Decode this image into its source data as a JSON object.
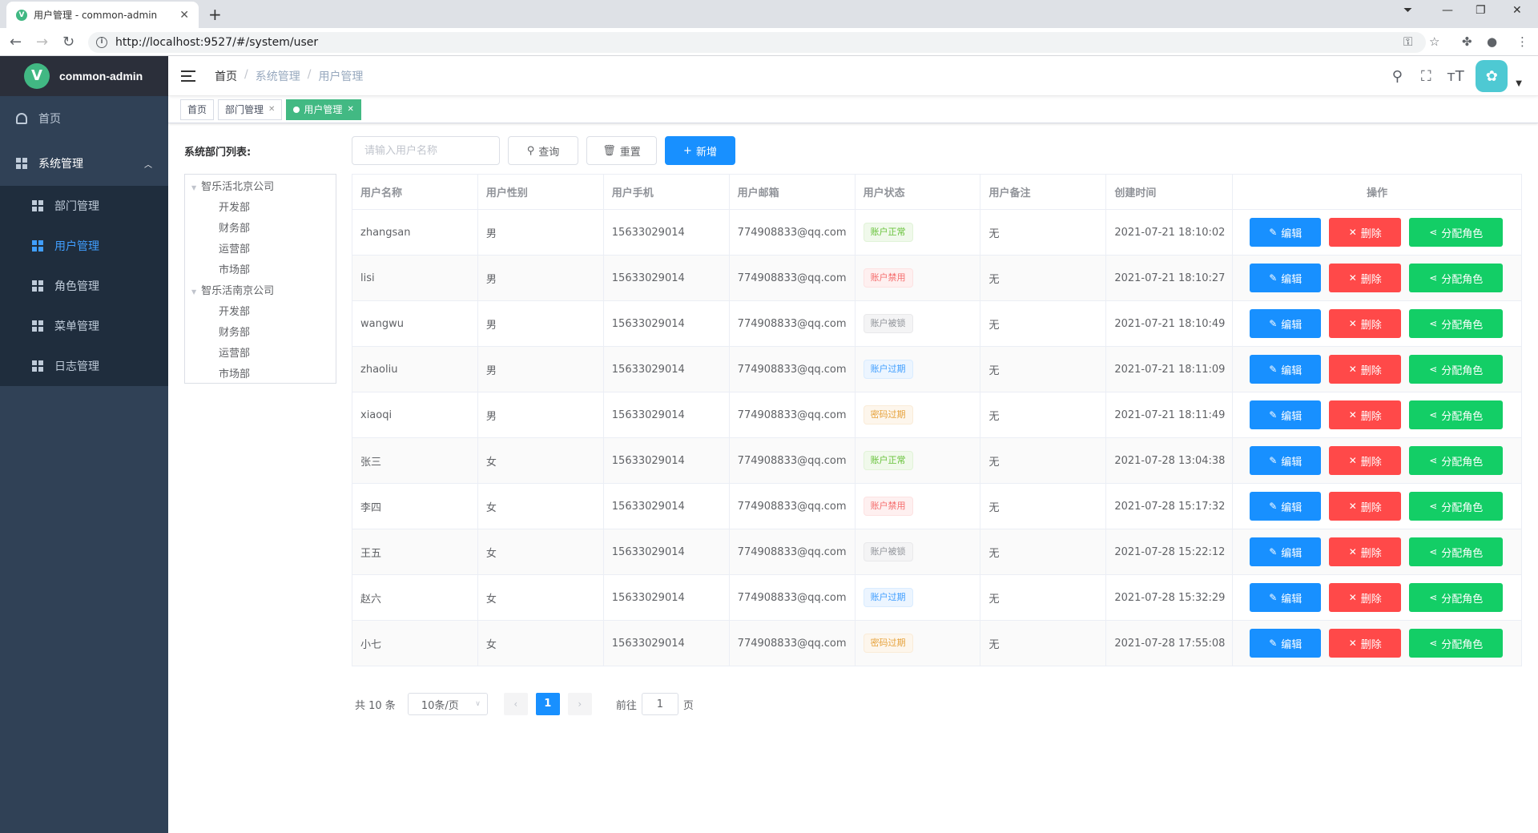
{
  "browser": {
    "tab_title": "用户管理 - common-admin",
    "url": "http://localhost:9527/#/system/user"
  },
  "logo": {
    "text": "common-admin"
  },
  "sidebar": {
    "home": "首页",
    "system": "系统管理",
    "items": [
      {
        "label": "部门管理"
      },
      {
        "label": "用户管理"
      },
      {
        "label": "角色管理"
      },
      {
        "label": "菜单管理"
      },
      {
        "label": "日志管理"
      }
    ]
  },
  "breadcrumb": {
    "b1": "首页",
    "b2": "系统管理",
    "b3": "用户管理"
  },
  "tags": {
    "t1": "首页",
    "t2": "部门管理",
    "t3": "用户管理"
  },
  "dept": {
    "title": "系统部门列表:",
    "company1": "智乐活北京公司",
    "company2": "智乐活南京公司",
    "c1": [
      "开发部",
      "财务部",
      "运营部",
      "市场部"
    ],
    "c2": [
      "开发部",
      "财务部",
      "运营部",
      "市场部"
    ]
  },
  "toolbar": {
    "search_placeholder": "请输入用户名称",
    "query": "查询",
    "reset": "重置",
    "add": "新增"
  },
  "table": {
    "headers": [
      "用户名称",
      "用户性别",
      "用户手机",
      "用户邮箱",
      "用户状态",
      "用户备注",
      "创建时间",
      "操作"
    ],
    "edit": "编辑",
    "delete": "删除",
    "assign": "分配角色",
    "rows": [
      {
        "name": "zhangsan",
        "gender": "男",
        "phone": "15633029014",
        "email": "774908833@qq.com",
        "status": "账户正常",
        "note": "无",
        "created": "2021-07-21 18:10:02"
      },
      {
        "name": "lisi",
        "gender": "男",
        "phone": "15633029014",
        "email": "774908833@qq.com",
        "status": "账户禁用",
        "note": "无",
        "created": "2021-07-21 18:10:27"
      },
      {
        "name": "wangwu",
        "gender": "男",
        "phone": "15633029014",
        "email": "774908833@qq.com",
        "status": "账户被锁",
        "note": "无",
        "created": "2021-07-21 18:10:49"
      },
      {
        "name": "zhaoliu",
        "gender": "男",
        "phone": "15633029014",
        "email": "774908833@qq.com",
        "status": "账户过期",
        "note": "无",
        "created": "2021-07-21 18:11:09"
      },
      {
        "name": "xiaoqi",
        "gender": "男",
        "phone": "15633029014",
        "email": "774908833@qq.com",
        "status": "密码过期",
        "note": "无",
        "created": "2021-07-21 18:11:49"
      },
      {
        "name": "张三",
        "gender": "女",
        "phone": "15633029014",
        "email": "774908833@qq.com",
        "status": "账户正常",
        "note": "无",
        "created": "2021-07-28 13:04:38"
      },
      {
        "name": "李四",
        "gender": "女",
        "phone": "15633029014",
        "email": "774908833@qq.com",
        "status": "账户禁用",
        "note": "无",
        "created": "2021-07-28 15:17:32"
      },
      {
        "name": "王五",
        "gender": "女",
        "phone": "15633029014",
        "email": "774908833@qq.com",
        "status": "账户被锁",
        "note": "无",
        "created": "2021-07-28 15:22:12"
      },
      {
        "name": "赵六",
        "gender": "女",
        "phone": "15633029014",
        "email": "774908833@qq.com",
        "status": "账户过期",
        "note": "无",
        "created": "2021-07-28 15:32:29"
      },
      {
        "name": "小七",
        "gender": "女",
        "phone": "15633029014",
        "email": "774908833@qq.com",
        "status": "密码过期",
        "note": "无",
        "created": "2021-07-28 17:55:08"
      }
    ]
  },
  "status_colors": {
    "账户正常": "st-green",
    "账户禁用": "st-red",
    "账户被锁": "st-gray",
    "账户过期": "st-blue",
    "密码过期": "st-orange"
  },
  "pager": {
    "total": "共 10 条",
    "size": "10条/页",
    "page": "1",
    "goto": "前往",
    "goto_value": "1",
    "suffix": "页"
  }
}
